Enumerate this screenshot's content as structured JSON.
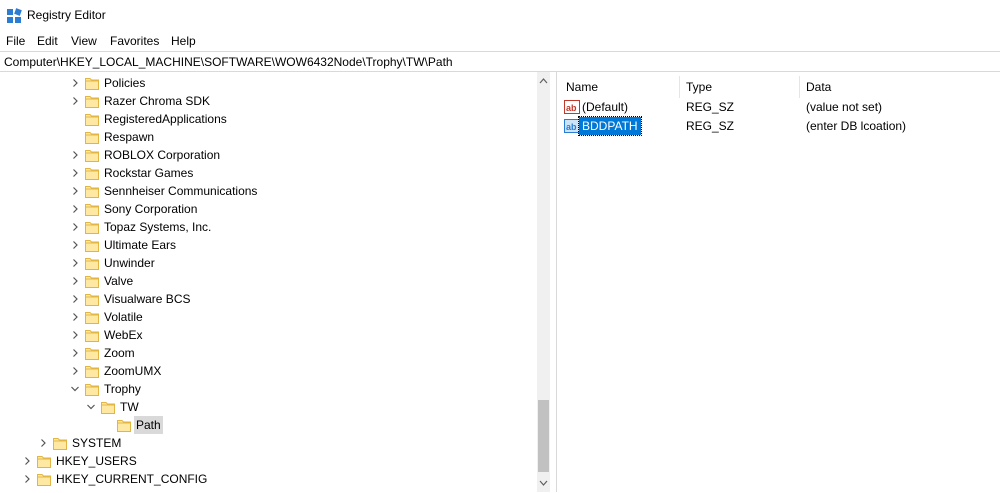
{
  "window": {
    "title": "Registry Editor"
  },
  "menu": [
    "File",
    "Edit",
    "View",
    "Favorites",
    "Help"
  ],
  "address": "Computer\\HKEY_LOCAL_MACHINE\\SOFTWARE\\WOW6432Node\\Trophy\\TW\\Path",
  "tree": [
    {
      "label": "Policies",
      "level": 3,
      "expander": "collapsed"
    },
    {
      "label": "Razer Chroma SDK",
      "level": 3,
      "expander": "collapsed"
    },
    {
      "label": "RegisteredApplications",
      "level": 3,
      "expander": "none"
    },
    {
      "label": "Respawn",
      "level": 3,
      "expander": "none"
    },
    {
      "label": "ROBLOX Corporation",
      "level": 3,
      "expander": "collapsed"
    },
    {
      "label": "Rockstar Games",
      "level": 3,
      "expander": "collapsed"
    },
    {
      "label": "Sennheiser Communications",
      "level": 3,
      "expander": "collapsed"
    },
    {
      "label": "Sony Corporation",
      "level": 3,
      "expander": "collapsed"
    },
    {
      "label": "Topaz Systems, Inc.",
      "level": 3,
      "expander": "collapsed"
    },
    {
      "label": "Ultimate Ears",
      "level": 3,
      "expander": "collapsed"
    },
    {
      "label": "Unwinder",
      "level": 3,
      "expander": "collapsed"
    },
    {
      "label": "Valve",
      "level": 3,
      "expander": "collapsed"
    },
    {
      "label": "Visualware BCS",
      "level": 3,
      "expander": "collapsed"
    },
    {
      "label": "Volatile",
      "level": 3,
      "expander": "collapsed"
    },
    {
      "label": "WebEx",
      "level": 3,
      "expander": "collapsed"
    },
    {
      "label": "Zoom",
      "level": 3,
      "expander": "collapsed"
    },
    {
      "label": "ZoomUMX",
      "level": 3,
      "expander": "collapsed"
    },
    {
      "label": "Trophy",
      "level": 3,
      "expander": "expanded"
    },
    {
      "label": "TW",
      "level": 4,
      "expander": "expanded"
    },
    {
      "label": "Path",
      "level": 5,
      "expander": "none",
      "selected": true
    },
    {
      "label": "SYSTEM",
      "level": 1,
      "expander": "collapsed"
    },
    {
      "label": "HKEY_USERS",
      "level": 0,
      "expander": "collapsed"
    },
    {
      "label": "HKEY_CURRENT_CONFIG",
      "level": 0,
      "expander": "collapsed"
    }
  ],
  "list": {
    "columns": [
      "Name",
      "Type",
      "Data"
    ],
    "rows": [
      {
        "name": "(Default)",
        "type": "REG_SZ",
        "data": "(value not set)",
        "selected": false
      },
      {
        "name": "BDDPATH",
        "type": "REG_SZ",
        "data": "(enter DB lcoation)",
        "selected": true
      }
    ]
  },
  "colors": {
    "selection": "#0078d7",
    "folder": "#ffe8a1",
    "folder_edge": "#e3b644"
  }
}
